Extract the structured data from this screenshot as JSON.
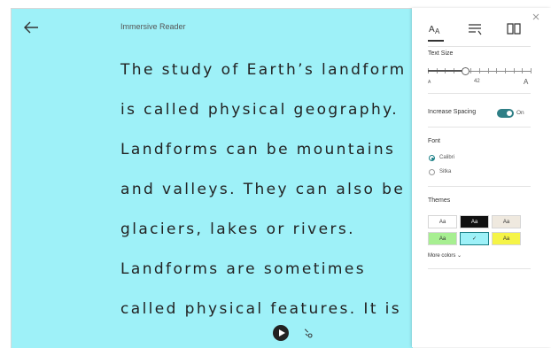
{
  "reader": {
    "title": "Immersive Reader",
    "lines": [
      "The study of Earth’s landform",
      "is called physical geography.",
      "Landforms can be mountains",
      "and valleys. They can also be",
      "glaciers, lakes or rivers.",
      "Landforms are sometimes",
      "called physical features. It is"
    ]
  },
  "panel": {
    "tabs": [
      "text-preferences-icon",
      "grammar-options-icon",
      "reading-preferences-icon"
    ],
    "text_size": {
      "label": "Text Size",
      "value": 42,
      "value_text": "42",
      "fraction": 0.36,
      "min_label": "A",
      "max_label": "A"
    },
    "spacing": {
      "label": "Increase Spacing",
      "state": "On"
    },
    "font": {
      "label": "Font",
      "options": [
        "Calibri",
        "Sitka"
      ],
      "selected": "Calibri"
    },
    "themes": {
      "label": "Themes",
      "swatches": [
        {
          "text": "Aa",
          "bg": "#ffffff",
          "fg": "#333333"
        },
        {
          "text": "Aa",
          "bg": "#111111",
          "fg": "#ffffff"
        },
        {
          "text": "Aa",
          "bg": "#efe9df",
          "fg": "#333333"
        },
        {
          "text": "Aa",
          "bg": "#a7ef91",
          "fg": "#333333"
        },
        {
          "text": "✓",
          "bg": "#9ef1f8",
          "fg": "#333333",
          "selected": true
        },
        {
          "text": "Aa",
          "bg": "#f5f447",
          "fg": "#333333"
        }
      ],
      "more_label": "More colors"
    }
  },
  "colors": {
    "reader_bg": "#9ef1f8",
    "accent": "#1a7f86"
  }
}
